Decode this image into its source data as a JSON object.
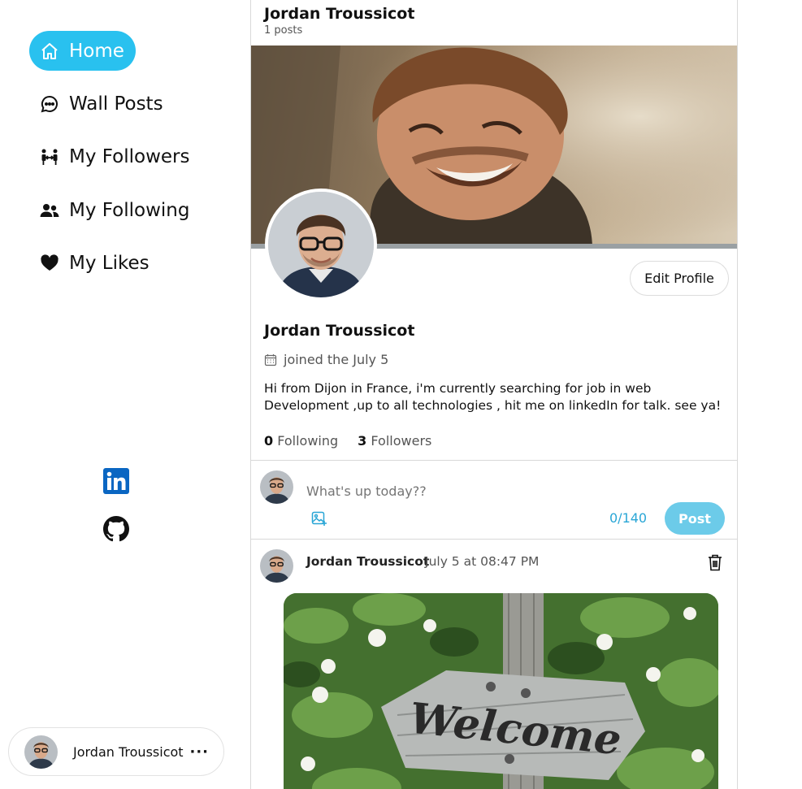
{
  "sidebar": {
    "items": [
      {
        "label": "Home",
        "icon": "home-icon",
        "active": true
      },
      {
        "label": "Wall Posts",
        "icon": "chat-bubble-icon"
      },
      {
        "label": "My Followers",
        "icon": "followers-icon"
      },
      {
        "label": "My Following",
        "icon": "users-icon"
      },
      {
        "label": "My Likes",
        "icon": "heart-icon"
      }
    ],
    "social": [
      {
        "icon": "linkedin-icon"
      },
      {
        "icon": "github-icon"
      }
    ],
    "user_card": {
      "name": "Jordan Troussicot",
      "menu": "···"
    }
  },
  "header": {
    "title": "Jordan Troussicot",
    "subtitle": "1 posts"
  },
  "profile": {
    "edit_label": "Edit Profile",
    "name": "Jordan Troussicot",
    "joined": "joined the July 5",
    "bio": "Hi from Dijon in France, i'm currently searching for job in web Development ,up to all technologies , hit me on linkedIn for talk. see ya!",
    "following_count": "0",
    "following_label": "Following",
    "followers_count": "3",
    "followers_label": "Followers"
  },
  "composer": {
    "placeholder": "What's up today??",
    "counter": "0/140",
    "post_label": "Post"
  },
  "post": {
    "author": "Jordan Troussicot",
    "date": "July 5 at 08:47 PM",
    "image_text": "Welcome"
  },
  "colors": {
    "accent": "#29c1ef",
    "post_button": "#6ccbe9",
    "counter": "#29a6d6"
  }
}
